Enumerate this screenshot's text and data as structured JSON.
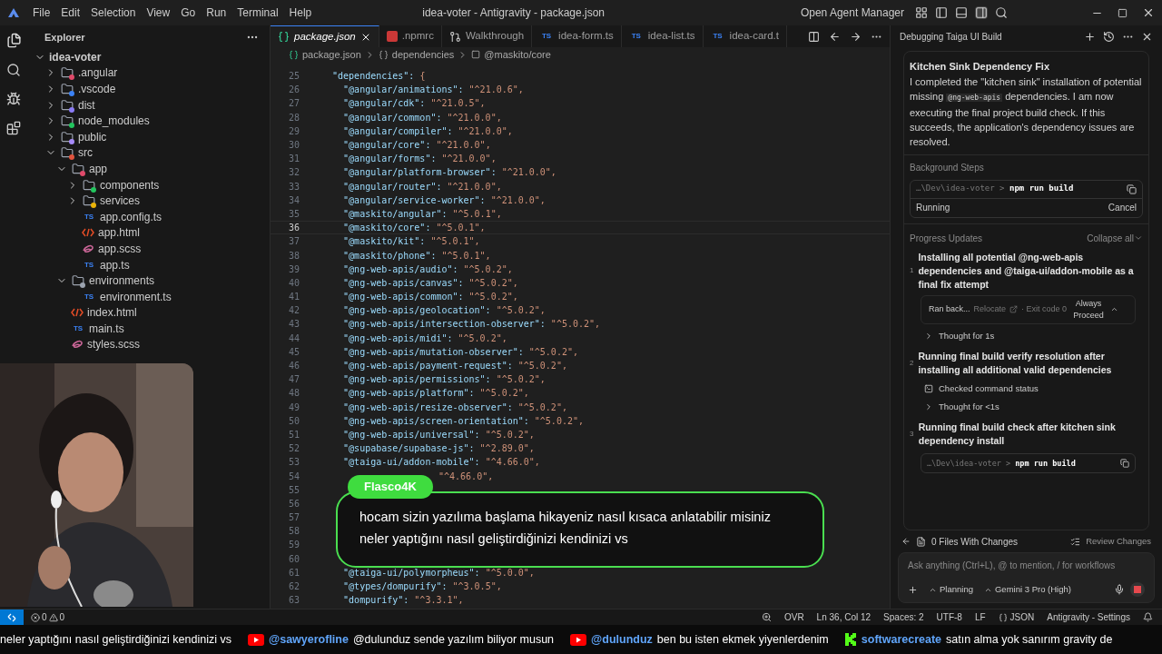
{
  "title_bar": {
    "menu": [
      "File",
      "Edit",
      "Selection",
      "View",
      "Go",
      "Run",
      "Terminal",
      "Help"
    ],
    "title": "idea-voter - Antigravity - package.json",
    "agent_manager": "Open Agent Manager"
  },
  "sidebar": {
    "title": "Explorer",
    "tree": [
      {
        "name": "idea-voter",
        "kind": "root",
        "expanded": true,
        "children": [
          {
            "name": ".angular",
            "kind": "folder",
            "expanded": false,
            "color": "#e04a6a"
          },
          {
            "name": ".vscode",
            "kind": "folder",
            "expanded": false,
            "color": "#3b82f6"
          },
          {
            "name": "dist",
            "kind": "folder",
            "expanded": false,
            "color": "#8b7cf6"
          },
          {
            "name": "node_modules",
            "kind": "folder",
            "expanded": false,
            "color": "#22c55e"
          },
          {
            "name": "public",
            "kind": "folder",
            "expanded": false,
            "color": "#a78bfa"
          },
          {
            "name": "src",
            "kind": "folder",
            "expanded": true,
            "color": "#e0533d",
            "children": [
              {
                "name": "app",
                "kind": "folder",
                "expanded": true,
                "color": "#e04a6a",
                "children": [
                  {
                    "name": "components",
                    "kind": "folder",
                    "expanded": false,
                    "color": "#22c55e"
                  },
                  {
                    "name": "services",
                    "kind": "folder",
                    "expanded": false,
                    "color": "#eab308"
                  },
                  {
                    "name": "app.config.ts",
                    "kind": "ts",
                    "badge": "TS"
                  },
                  {
                    "name": "app.html",
                    "kind": "html"
                  },
                  {
                    "name": "app.scss",
                    "kind": "scss"
                  },
                  {
                    "name": "app.ts",
                    "kind": "ts",
                    "badge": "TS"
                  }
                ]
              },
              {
                "name": "environments",
                "kind": "folder",
                "expanded": true,
                "color": "#9ca3af",
                "children": [
                  {
                    "name": "environment.ts",
                    "kind": "ts",
                    "badge": "TS"
                  }
                ]
              },
              {
                "name": "index.html",
                "kind": "html"
              },
              {
                "name": "main.ts",
                "kind": "ts",
                "badge": "TS"
              },
              {
                "name": "styles.scss",
                "kind": "scss"
              }
            ]
          }
        ]
      }
    ]
  },
  "tabs": [
    {
      "label": "package.json",
      "kind": "json",
      "selected": true
    },
    {
      "label": ".npmrc",
      "kind": "npm",
      "selected": false
    },
    {
      "label": "Walkthrough",
      "kind": "walk",
      "selected": false
    },
    {
      "label": "idea-form.ts",
      "kind": "ts",
      "badge": "TS",
      "selected": false
    },
    {
      "label": "idea-list.ts",
      "kind": "ts",
      "badge": "TS",
      "selected": false
    },
    {
      "label": "idea-card.t",
      "kind": "ts",
      "badge": "TS",
      "selected": false
    }
  ],
  "breadcrumb": [
    "package.json",
    "dependencies",
    "@maskito/core"
  ],
  "code": [
    {
      "n": "25",
      "key": "  \"dependencies\":",
      "value": " {",
      "current": false
    },
    {
      "n": "26",
      "key": "    \"@angular/animations\":",
      "value": " \"^21.0.6\",",
      "current": false
    },
    {
      "n": "27",
      "key": "    \"@angular/cdk\":",
      "value": " \"^21.0.5\",",
      "current": false
    },
    {
      "n": "28",
      "key": "    \"@angular/common\":",
      "value": " \"^21.0.0\",",
      "current": false
    },
    {
      "n": "29",
      "key": "    \"@angular/compiler\":",
      "value": " \"^21.0.0\",",
      "current": false
    },
    {
      "n": "30",
      "key": "    \"@angular/core\":",
      "value": " \"^21.0.0\",",
      "current": false
    },
    {
      "n": "31",
      "key": "    \"@angular/forms\":",
      "value": " \"^21.0.0\",",
      "current": false
    },
    {
      "n": "32",
      "key": "    \"@angular/platform-browser\":",
      "value": " \"^21.0.0\",",
      "current": false
    },
    {
      "n": "33",
      "key": "    \"@angular/router\":",
      "value": " \"^21.0.0\",",
      "current": false
    },
    {
      "n": "34",
      "key": "    \"@angular/service-worker\":",
      "value": " \"^21.0.0\",",
      "current": false
    },
    {
      "n": "35",
      "key": "    \"@maskito/angular\":",
      "value": " \"^5.0.1\",",
      "current": false
    },
    {
      "n": "36",
      "key": "    \"@maskito/core\":",
      "value": " \"^5.0.1\",",
      "current": true
    },
    {
      "n": "37",
      "key": "    \"@maskito/kit\":",
      "value": " \"^5.0.1\",",
      "current": false
    },
    {
      "n": "38",
      "key": "    \"@maskito/phone\":",
      "value": " \"^5.0.1\",",
      "current": false
    },
    {
      "n": "39",
      "key": "    \"@ng-web-apis/audio\":",
      "value": " \"^5.0.2\",",
      "current": false
    },
    {
      "n": "40",
      "key": "    \"@ng-web-apis/canvas\":",
      "value": " \"^5.0.2\",",
      "current": false
    },
    {
      "n": "41",
      "key": "    \"@ng-web-apis/common\":",
      "value": " \"^5.0.2\",",
      "current": false
    },
    {
      "n": "42",
      "key": "    \"@ng-web-apis/geolocation\":",
      "value": " \"^5.0.2\",",
      "current": false
    },
    {
      "n": "43",
      "key": "    \"@ng-web-apis/intersection-observer\":",
      "value": " \"^5.0.2\",",
      "current": false
    },
    {
      "n": "44",
      "key": "    \"@ng-web-apis/midi\":",
      "value": " \"^5.0.2\",",
      "current": false
    },
    {
      "n": "45",
      "key": "    \"@ng-web-apis/mutation-observer\":",
      "value": " \"^5.0.2\",",
      "current": false
    },
    {
      "n": "46",
      "key": "    \"@ng-web-apis/payment-request\":",
      "value": " \"^5.0.2\",",
      "current": false
    },
    {
      "n": "47",
      "key": "    \"@ng-web-apis/permissions\":",
      "value": " \"^5.0.2\",",
      "current": false
    },
    {
      "n": "48",
      "key": "    \"@ng-web-apis/platform\":",
      "value": " \"^5.0.2\",",
      "current": false
    },
    {
      "n": "49",
      "key": "    \"@ng-web-apis/resize-observer\":",
      "value": " \"^5.0.2\",",
      "current": false
    },
    {
      "n": "50",
      "key": "    \"@ng-web-apis/screen-orientation\":",
      "value": " \"^5.0.2\",",
      "current": false
    },
    {
      "n": "51",
      "key": "    \"@ng-web-apis/universal\":",
      "value": " \"^5.0.2\",",
      "current": false
    },
    {
      "n": "52",
      "key": "    \"@supabase/supabase-js\":",
      "value": " \"^2.89.0\",",
      "current": false
    },
    {
      "n": "53",
      "key": "    \"@taiga-ui/addon-mobile\":",
      "value": " \"^4.66.0\",",
      "current": false
    },
    {
      "n": "54",
      "value": "\"^4.66.0\",",
      "current": false
    },
    {
      "n": "55",
      "current": false
    },
    {
      "n": "56",
      "current": false
    },
    {
      "n": "57",
      "current": false
    },
    {
      "n": "58",
      "current": false
    },
    {
      "n": "59",
      "current": false
    },
    {
      "n": "60",
      "current": false
    },
    {
      "n": "61",
      "key": "    \"@taiga-ui/polymorpheus\":",
      "value": " \"^5.0.0\",",
      "current": false
    },
    {
      "n": "62",
      "key": "    \"@types/dompurify\":",
      "value": " \"^3.0.5\",",
      "current": false
    },
    {
      "n": "63",
      "key": "    \"dompurify\":",
      "value": " \"^3.3.1\",",
      "current": false
    }
  ],
  "chat_overlay": {
    "user": "Flasco4K",
    "message": "hocam sizin yazılıma başlama hikayeniz nasıl kısaca anlatabilir misiniz neler yaptığını nasıl geliştirdiğinizi kendinizi vs"
  },
  "agent_panel": {
    "title": "Debugging Taiga UI Build",
    "summary": {
      "title": "Kitchen Sink Dependency Fix",
      "text_before": "I completed the \"kitchen sink\" installation of potential missing ",
      "code": "@ng-web-apis",
      "text_after": " dependencies. I am now executing the final project build check. If this succeeds, the application's dependency issues are resolved."
    },
    "background": {
      "label": "Background Steps",
      "path": "…\\Dev\\idea-voter >",
      "command": "npm run build",
      "status": "Running",
      "action": "Cancel"
    },
    "progress": {
      "label": "Progress Updates",
      "collapse": "Collapse all",
      "steps": [
        {
          "number": "1",
          "title": "Installing all potential @ng-web-apis dependencies and @taiga-ui/addon-mobile as a final fix attempt",
          "items": [
            {
              "kind": "ran",
              "text": "Ran back...",
              "link": "Relocate",
              "exit": "· Exit code 0",
              "action": "Always Proceed"
            },
            {
              "kind": "thought",
              "text": "Thought for 1s"
            }
          ]
        },
        {
          "number": "2",
          "title": "Running final build verify resolution after installing all additional valid dependencies",
          "items": [
            {
              "kind": "status",
              "text": "Checked command status"
            },
            {
              "kind": "thought",
              "text": "Thought for <1s"
            }
          ]
        },
        {
          "number": "3",
          "title": "Running final build check after kitchen sink dependency install",
          "items": [
            {
              "kind": "terminal",
              "path": "…\\Dev\\idea-voter >",
              "command": "npm run build"
            }
          ]
        }
      ]
    },
    "files": "0 Files With Changes",
    "review": "Review Changes",
    "input": {
      "placeholder": "Ask anything (Ctrl+L), @ to mention, / for workflows",
      "mode": "Planning",
      "model": "Gemini 3 Pro (High)"
    }
  },
  "status_bar": {
    "errors": "0",
    "warnings": "0",
    "right": [
      "OVR",
      "Ln 36, Col 12",
      "Spaces: 2",
      "UTF-8",
      "LF",
      "JSON",
      "Antigravity - Settings"
    ]
  },
  "ticker": [
    {
      "kind": "plain",
      "text": "neler yaptığını nasıl geliştirdiğinizi kendinizi vs"
    },
    {
      "kind": "youtube",
      "user": "@sawyerofline",
      "text": "@dulunduz sende yazılım biliyor musun"
    },
    {
      "kind": "youtube",
      "user": "@dulunduz",
      "text": "ben bu isten ekmek yiyenlerdenim"
    },
    {
      "kind": "kick",
      "user": "softwarecreate",
      "text": "satın alma yok sanırım gravity de"
    }
  ]
}
